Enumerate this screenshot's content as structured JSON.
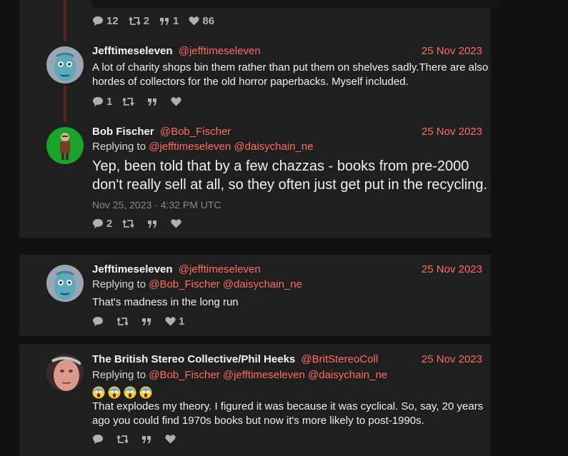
{
  "tweets": [
    {
      "stats": {
        "comments": "12",
        "retweets": "2",
        "quotes": "1",
        "likes": "86"
      }
    },
    {
      "fullname": "Jefftimeseleven",
      "username": "@jefftimeseleven",
      "date": "25 Nov 2023",
      "content": "A lot of charity shops bin them rather than put them on shelves sadly.There are also hordes of collectors for the old horror paperbacks. Myself included.",
      "stats": {
        "comments": "1",
        "retweets": "",
        "quotes": "",
        "likes": ""
      }
    },
    {
      "fullname": "Bob Fischer",
      "username": "@Bob_Fischer",
      "date": "25 Nov 2023",
      "replying_label": "Replying to",
      "replying": [
        "@jefftimeseleven",
        "@daisychain_ne"
      ],
      "content": "Yep, been told that by a few chazzas - books from pre-2000 don't really sell at all, so they often just get put in the recycling.",
      "published": "Nov 25, 2023 · 4:32 PM UTC",
      "stats": {
        "comments": "2",
        "retweets": "",
        "quotes": "",
        "likes": ""
      }
    },
    {
      "fullname": "Jefftimeseleven",
      "username": "@jefftimeseleven",
      "date": "25 Nov 2023",
      "replying_label": "Replying to",
      "replying": [
        "@Bob_Fischer",
        "@daisychain_ne"
      ],
      "content": "That's madness in the long run",
      "stats": {
        "comments": "",
        "retweets": "",
        "quotes": "",
        "likes": "1"
      }
    },
    {
      "fullname": "The British Stereo Collective/Phil Heeks",
      "username": "@BritStereoColl",
      "date": "25 Nov 2023",
      "replying_label": "Replying to",
      "replying": [
        "@Bob_Fischer",
        "@jefftimeseleven",
        "@daisychain_ne"
      ],
      "emoji_icons": [
        "screaming-face-emoji",
        "screaming-face-emoji",
        "screaming-face-emoji",
        "screaming-face-emoji"
      ],
      "content": "That explodes my theory. I figured it was because it was cyclical. So, say, 20 years ago you could find 1970s books but now it's more likely to post-1990s.",
      "stats": {
        "comments": "",
        "retweets": "",
        "quotes": "",
        "likes": ""
      }
    }
  ],
  "colors": {
    "accent": "#ff6c60",
    "card": "#1f1f1f",
    "background": "#111111",
    "thread_line": "#5c2222"
  }
}
